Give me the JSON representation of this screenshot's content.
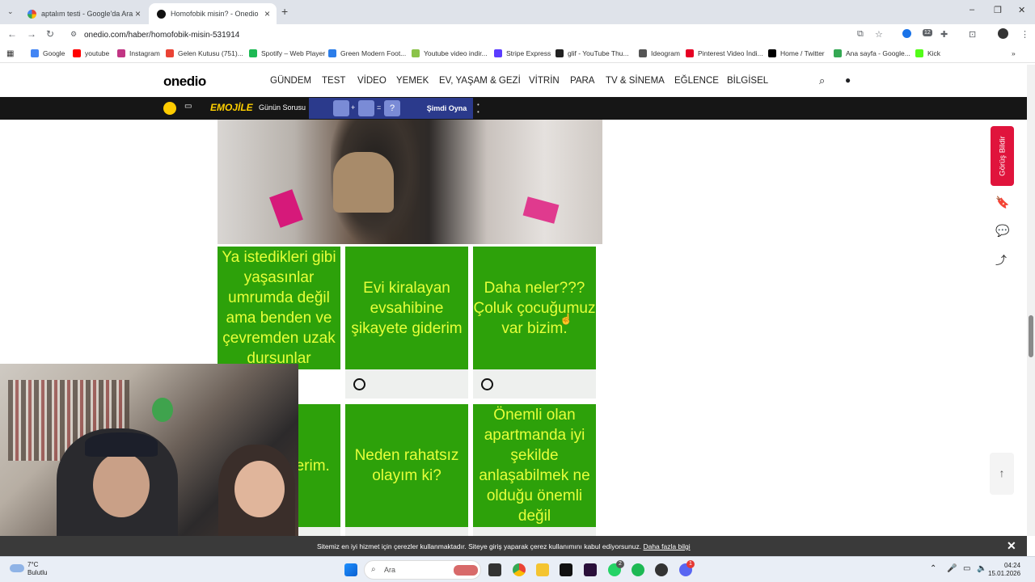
{
  "browser": {
    "tabs": [
      {
        "label": "aptalım testi - Google'da Ara",
        "active": false
      },
      {
        "label": "Homofobik misin? - Onedio",
        "active": true
      }
    ],
    "new_tab": "+",
    "url": "onedio.com/haber/homofobik-misin-531914",
    "bookmarks": [
      "Google",
      "youtube",
      "Instagram",
      "Gelen Kutusu (751)...",
      "Spotify – Web Player",
      "Green Modern Foot...",
      "Youtube video indir...",
      "Stripe Express",
      "glif - YouTube Thu...",
      "Ideogram",
      "Pinterest Video İndi...",
      "Home / Twitter",
      "Ana sayfa - Google...",
      "Kick"
    ],
    "extension_badge": "12"
  },
  "site": {
    "logo": "onedio",
    "nav": [
      "GÜNDEM",
      "TEST",
      "VİDEO",
      "YEMEK",
      "EV, YAŞAM & GEZİ",
      "VİTRİN",
      "PARA",
      "TV & SİNEMA",
      "EĞLENCE",
      "BİLGİSEL"
    ],
    "emoji_bar": {
      "title": "EMOJİLE",
      "question": "Günün Sorusu",
      "play": "Şimdi Oyna",
      "operators": [
        "+",
        "=",
        "?"
      ]
    }
  },
  "quiz": {
    "answers": [
      "Ya istedikleri gibi yaşasınlar umrumda değil ama benden ve çevremden uzak dursunlar",
      "Evi kiralayan evsahibine şikayete giderim",
      "Daha neler??? Çoluk çocuğumuz var bizim.",
      "...p hoş ...erim.",
      "Neden rahatsız olayım ki?",
      "Önemli olan apartmanda iyi şekilde anlaşabilmek ne olduğu önemli değil"
    ]
  },
  "right_rail": {
    "feedback": "Görüş Bildir"
  },
  "cookie": {
    "message": "Sitemiz en iyi hizmet için çerezler kullanmaktadır. Siteye giriş yaparak çerez kullanımını kabul ediyorsunuz.",
    "link": "Daha fazla bilgi",
    "close": "✕"
  },
  "taskbar": {
    "weather_temp": "7°C",
    "weather_desc": "Bulutlu",
    "search_placeholder": "Ara",
    "time": "04:24",
    "date": "15.01.2026",
    "badges": [
      "2",
      "1"
    ]
  }
}
